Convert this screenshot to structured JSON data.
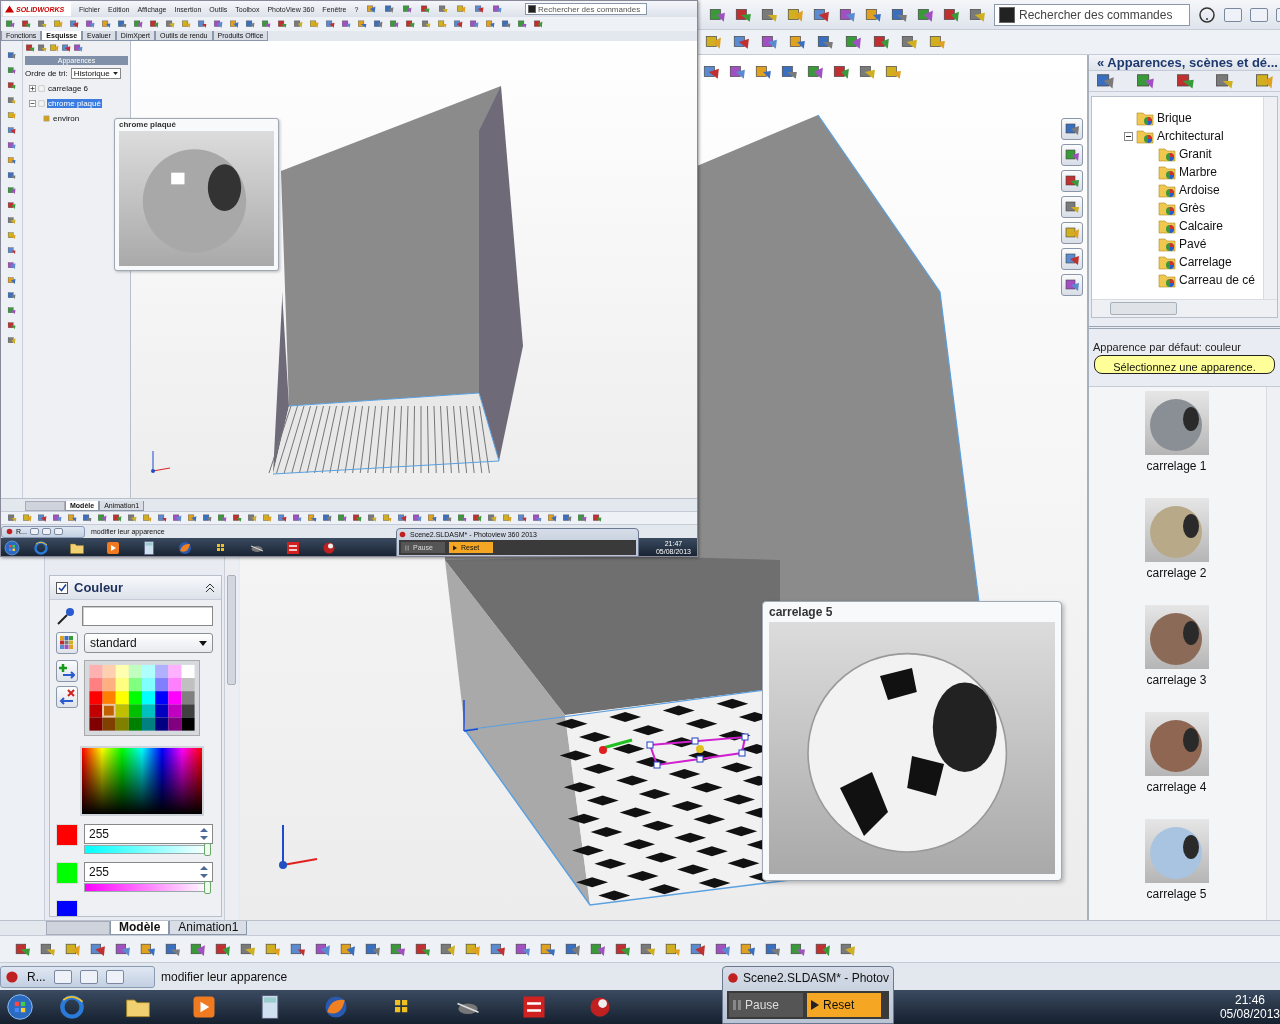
{
  "inset_screenshot": {
    "menu": {
      "logo": "SOLIDWORKS",
      "items": [
        "Fichier",
        "Edition",
        "Affichage",
        "Insertion",
        "Outils",
        "Toolbox",
        "PhotoView 360",
        "Fenêtre",
        "?"
      ],
      "search_placeholder": "Rechercher des commandes"
    },
    "tabs": [
      {
        "label": "Fonctions",
        "selected": false
      },
      {
        "label": "Esquisse",
        "selected": true
      },
      {
        "label": "Evaluer",
        "selected": false
      },
      {
        "label": "DimXpert",
        "selected": false
      },
      {
        "label": "Outils de rendu",
        "selected": false
      },
      {
        "label": "Produits Office",
        "selected": false
      }
    ],
    "panel": {
      "title": "Apparences",
      "sort_label": "Ordre de tri:",
      "sort_value": "Historique",
      "tree": [
        {
          "label": "carrelage 6",
          "selected": false,
          "expanded": false
        },
        {
          "label": "chrome plaqué",
          "selected": true,
          "expanded": true,
          "children": [
            {
              "label": "environ",
              "selected": false
            }
          ]
        }
      ]
    },
    "tooltip": {
      "title": "chrome plaqué"
    },
    "bottom_tabs": [
      {
        "label": "Modèle",
        "selected": true
      },
      {
        "label": "Animation1",
        "selected": false
      }
    ],
    "status": {
      "window_label": "R...",
      "message": "modifier leur apparence"
    },
    "photoview": {
      "title": "Scene2.SLDASM* - Photoview 360 2013",
      "buttons": [
        {
          "label": "Pause",
          "highlighted": false
        },
        {
          "label": "Reset",
          "highlighted": true
        }
      ]
    },
    "clock": {
      "time": "21:47",
      "date": "05/08/2013"
    }
  },
  "toolbar": {
    "search_placeholder": "Rechercher des commandes"
  },
  "property_panel": {
    "section": {
      "title": "Couleur",
      "checked": true
    },
    "palette_set": "standard",
    "channels": [
      {
        "color": "#ff0000",
        "value": "255",
        "level": 1
      },
      {
        "color": "#00ff00",
        "value": "255",
        "level": 1
      },
      {
        "color": "#0000ff"
      }
    ]
  },
  "viewport": {
    "tooltip": {
      "title": "carrelage 5"
    }
  },
  "task_pane": {
    "title": "« Apparences, scènes et dé...",
    "tree": [
      {
        "label": "Brique"
      },
      {
        "label": "Architectural",
        "expanded": true,
        "children": [
          {
            "label": "Granit"
          },
          {
            "label": "Marbre"
          },
          {
            "label": "Ardoise"
          },
          {
            "label": "Grès"
          },
          {
            "label": "Calcaire"
          },
          {
            "label": "Pavé"
          },
          {
            "label": "Carrelage"
          },
          {
            "label": "Carreau de cé"
          }
        ]
      }
    ],
    "default_label": "Apparence par défaut: couleur",
    "hint": "Sélectionnez une apparence.",
    "thumbnails": [
      {
        "label": "carrelage 1",
        "color": "#8a8f96"
      },
      {
        "label": "carrelage 2",
        "color": "#b8aa88"
      },
      {
        "label": "carrelage 3",
        "color": "#8c6a58"
      },
      {
        "label": "carrelage 4",
        "color": "#8e6652"
      },
      {
        "label": "carrelage 5",
        "color": "#a8c4e0"
      }
    ]
  },
  "bottom_tabs": [
    {
      "label": "Modèle",
      "selected": true
    },
    {
      "label": "Animation1",
      "selected": false
    }
  ],
  "status": {
    "window_label": "R...",
    "message": "modifier leur apparence"
  },
  "photoview": {
    "title": "Scene2.SLDASM* - Photov",
    "buttons": [
      {
        "label": "Pause",
        "highlighted": false
      },
      {
        "label": "Reset",
        "highlighted": true
      }
    ]
  },
  "clock": {
    "time": "21:46",
    "date": "05/08/2013"
  }
}
